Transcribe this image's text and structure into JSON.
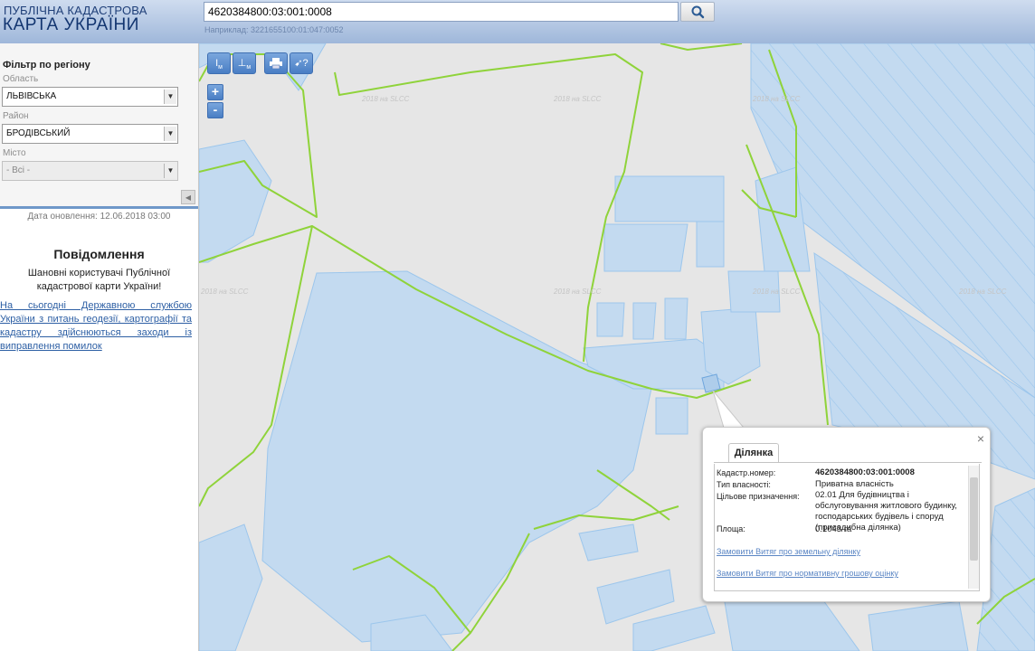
{
  "header": {
    "logo_line1": "ПУБЛІЧНА КАДАСТРОВА",
    "logo_line2": "КАРТА УКРАЇНИ",
    "search_value": "4620384800:03:001:0008",
    "search_hint": "Наприклад: 3221655100:01:047:0052",
    "search_icon": "search-icon"
  },
  "sidebar": {
    "filter_title": "Фільтр по регіону",
    "oblast_label": "Область",
    "oblast_value": "ЛЬВІВСЬКА",
    "rayon_label": "Район",
    "rayon_value": "БРОДІВСЬКИЙ",
    "misto_label": "Місто",
    "misto_value": "- Всі -",
    "collapse_icon": "chevron-left-icon",
    "update_date": "Дата оновлення: 12.06.2018 03:00",
    "notice_title": "Повідомлення",
    "notice_body": "Шановні користувачі Публічної кадастрової карти України!",
    "notice_link": "На сьогодні Державною службою України з питань геодезії, картографії та кадастру здійснюються заходи із виправлення помилок"
  },
  "toolbar": {
    "measure_length": "I м",
    "measure_area": "I м²",
    "print": "print-icon",
    "info": "identify-icon",
    "zoom_in": "+",
    "zoom_out": "-"
  },
  "watermark": "2018 на SLCC",
  "popup": {
    "tab": "Ділянка",
    "close": "×",
    "fields": [
      {
        "key": "Кадастр.номер:",
        "value": "4620384800:03:001:0008"
      },
      {
        "key": "Тип власності:",
        "value": "Приватна власність"
      },
      {
        "key": "Цільове призначення:",
        "value": "02.01 Для будівництва і обслуговування житлового будинку, господарських будівель і споруд (присадибна ділянка)"
      },
      {
        "key": "Площа:",
        "value": "0.1043 га"
      }
    ],
    "link1": "Замовити Витяг про земельну ділянку",
    "link2": "Замовити Витяг про нормативну грошову оцінку"
  },
  "colors": {
    "header_bg": "#b5c8e6",
    "parcel_fill": "#c3daf0",
    "parcel_stroke": "#9cc6ec",
    "boundary": "#8fd33a",
    "map_bg": "#e6e6e6",
    "link": "#2d5fa4"
  }
}
